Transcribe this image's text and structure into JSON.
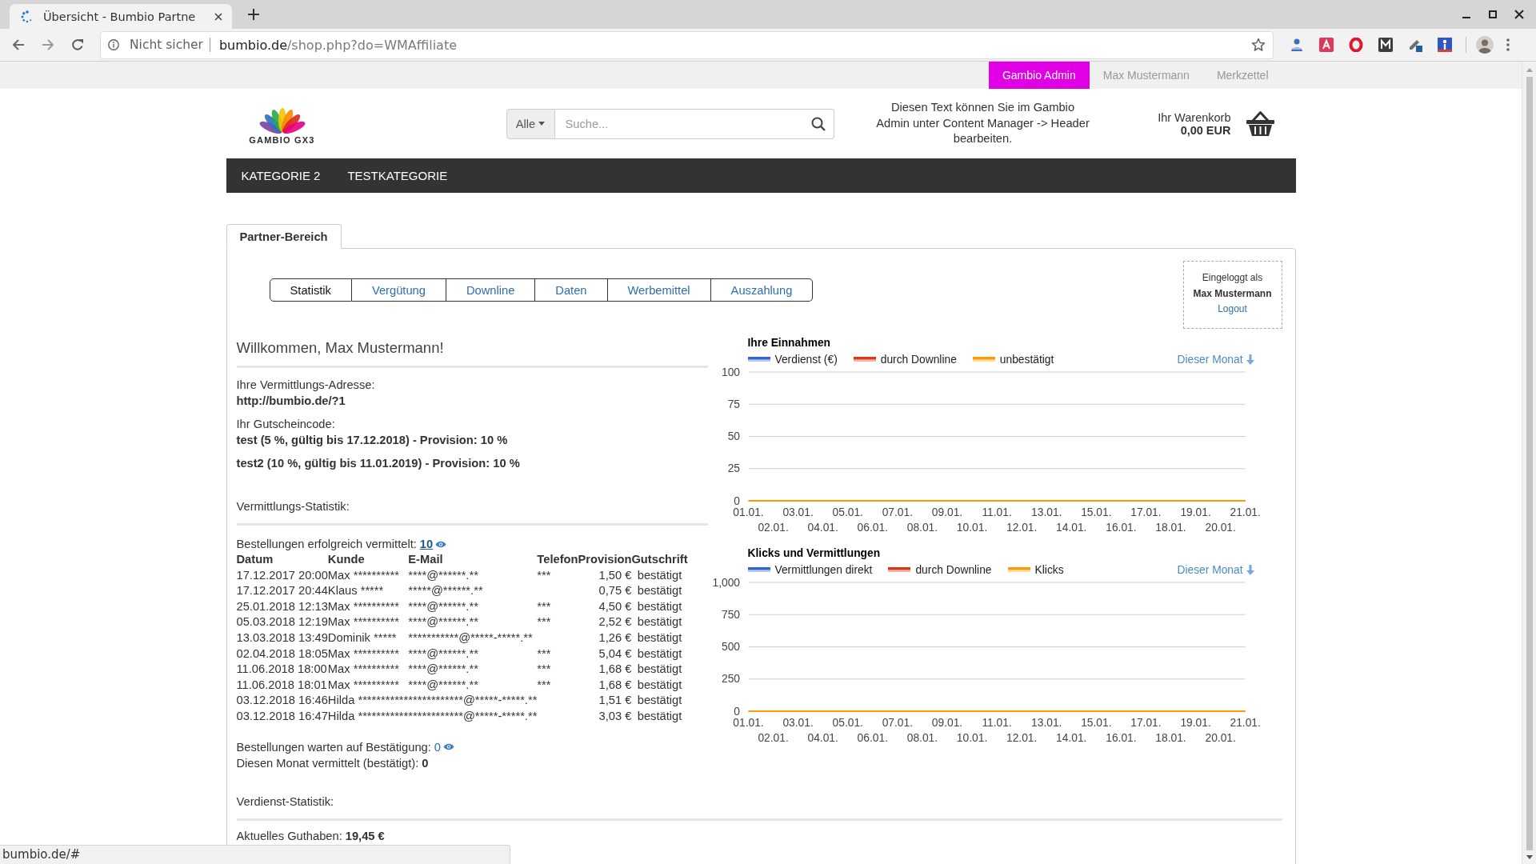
{
  "browser": {
    "tab": {
      "title": "Übersicht - Bumbio Partne",
      "loading": true
    },
    "address": {
      "security": "Nicht sicher",
      "host": "bumbio.de",
      "path": "/shop.php?do=WMAffiliate"
    }
  },
  "topbar": {
    "links": [
      {
        "label": "Gambio Admin",
        "kind": "admin"
      },
      {
        "label": "Max Mustermann",
        "kind": "link"
      },
      {
        "label": "Merkzettel",
        "kind": "link"
      }
    ]
  },
  "header": {
    "logo_text": "GAMBIO GX3",
    "search": {
      "category": "Alle",
      "placeholder": "Suche..."
    },
    "notice": "Diesen Text können Sie im Gambio\nAdmin unter Content Manager -> Header\nbearbeiten.",
    "cart": {
      "label": "Ihr Warenkorb",
      "total": "0,00 EUR"
    }
  },
  "nav": {
    "items": [
      {
        "label": "KATEGORIE 2"
      },
      {
        "label": "TESTKATEGORIE"
      }
    ]
  },
  "section_tab": {
    "label": "Partner-Bereich"
  },
  "subtabs": [
    {
      "label": "Statistik",
      "selected": true
    },
    {
      "label": "Vergütung",
      "selected": false
    },
    {
      "label": "Downline",
      "selected": false
    },
    {
      "label": "Daten",
      "selected": false
    },
    {
      "label": "Werbemittel",
      "selected": false
    },
    {
      "label": "Auszahlung",
      "selected": false
    }
  ],
  "login_box": {
    "label": "Eingeloggt als",
    "user": "Max Mustermann",
    "logout": "Logout"
  },
  "welcome": "Willkommen, Max Mustermann!",
  "referral": {
    "label": "Ihre Vermittlungs-Adresse:",
    "url": "http://bumbio.de/?1"
  },
  "vouchers": {
    "label": "Ihr Gutscheincode:",
    "codes": [
      "test (5 %, gültig bis 17.12.2018) - Provision: 10 %",
      "test2 (10 %, gültig bis 11.01.2019) - Provision: 10 %"
    ]
  },
  "referral_stats": {
    "heading": "Vermittlungs-Statistik:",
    "orders_label": "Bestellungen erfolgreich vermittelt:",
    "orders_count": "10",
    "table": {
      "columns": [
        "Datum",
        "Kunde",
        "E-Mail",
        "Telefon",
        "Provision",
        "Gutschrift"
      ],
      "rows": [
        {
          "date": "17.12.2017 20:00",
          "customer": "Max **********",
          "email": "****@******.**",
          "phone": "***",
          "provision": "1,50 €",
          "status": "bestätigt"
        },
        {
          "date": "17.12.2017 20:44",
          "customer": "Klaus *****",
          "email": "*****@******.**",
          "provision": "0,75 €",
          "status": "bestätigt"
        },
        {
          "date": "25.01.2018 12:13",
          "customer": "Max **********",
          "email": "****@******.**",
          "phone": "***",
          "provision": "4,50 €",
          "status": "bestätigt"
        },
        {
          "date": "05.03.2018 12:19",
          "customer": "Max **********",
          "email": "****@******.**",
          "phone": "***",
          "provision": "2,52 €",
          "status": "bestätigt"
        },
        {
          "date": "13.03.2018 13:49",
          "customer": "Dominik *****",
          "email": "***********@*****-*****.**",
          "provision": "1,26 €",
          "status": "bestätigt"
        },
        {
          "date": "02.04.2018 18:05",
          "customer": "Max **********",
          "email": "****@******.**",
          "phone": "***",
          "provision": "5,04 €",
          "status": "bestätigt"
        },
        {
          "date": "11.06.2018 18:00",
          "customer": "Max **********",
          "email": "****@******.**",
          "phone": "***",
          "provision": "1,68 €",
          "status": "bestätigt"
        },
        {
          "date": "11.06.2018 18:01",
          "customer": "Max **********",
          "email": "****@******.**",
          "phone": "***",
          "provision": "1,68 €",
          "status": "bestätigt"
        },
        {
          "date": "03.12.2018 16:46",
          "customer": "Hilda ***********",
          "email": "************@*****-*****.**",
          "provision": "1,51 €",
          "status": "bestätigt"
        },
        {
          "date": "03.12.2018 16:47",
          "customer": "Hilda ***********",
          "email": "************@*****-*****.**",
          "provision": "3,03 €",
          "status": "bestätigt"
        }
      ]
    },
    "pending_label": "Bestellungen warten auf Bestätigung:",
    "pending_count": "0",
    "month_label": "Diesen Monat vermittelt (bestätigt):",
    "month_count": "0"
  },
  "earnings_stats": {
    "heading": "Verdienst-Statistik:",
    "balance_label": "Aktuelles Guthaben:",
    "balance": "19,45 €"
  },
  "charts": [
    {
      "period_link": "Dieser Monat",
      "chart_data": {
        "type": "line",
        "title": "Ihre Einnahmen",
        "categories": [
          "01.01.",
          "02.01.",
          "03.01.",
          "04.01.",
          "05.01.",
          "06.01.",
          "07.01.",
          "08.01.",
          "09.01.",
          "10.01.",
          "11.01.",
          "12.01.",
          "13.01.",
          "14.01.",
          "15.01.",
          "16.01.",
          "17.01.",
          "18.01.",
          "19.01.",
          "20.01.",
          "21.01."
        ],
        "series": [
          {
            "name": "Verdienst (€)",
            "color": "#3366cc",
            "values": [
              null,
              null,
              null,
              null,
              null,
              null,
              null,
              null,
              null,
              null,
              null,
              null,
              null,
              null,
              null,
              null,
              null,
              null,
              null,
              null,
              null
            ]
          },
          {
            "name": "durch Downline",
            "color": "#dc3912",
            "values": [
              null,
              null,
              null,
              null,
              null,
              null,
              null,
              null,
              null,
              null,
              null,
              null,
              null,
              null,
              null,
              null,
              null,
              null,
              null,
              null,
              null
            ]
          },
          {
            "name": "unbestätigt",
            "color": "#ff9900",
            "values": [
              0,
              0,
              0,
              0,
              0,
              0,
              0,
              0,
              0,
              0,
              0,
              0,
              0,
              0,
              0,
              0,
              0,
              0,
              0,
              0,
              0
            ]
          }
        ],
        "ylim": [
          0,
          100
        ],
        "yticks": [
          0,
          25,
          50,
          75,
          100
        ],
        "grid": true,
        "legend": "top"
      }
    },
    {
      "period_link": "Dieser Monat",
      "chart_data": {
        "type": "line",
        "title": "Klicks und Vermittlungen",
        "categories": [
          "01.01.",
          "02.01.",
          "03.01.",
          "04.01.",
          "05.01.",
          "06.01.",
          "07.01.",
          "08.01.",
          "09.01.",
          "10.01.",
          "11.01.",
          "12.01.",
          "13.01.",
          "14.01.",
          "15.01.",
          "16.01.",
          "17.01.",
          "18.01.",
          "19.01.",
          "20.01.",
          "21.01."
        ],
        "series": [
          {
            "name": "Vermittlungen direkt",
            "color": "#3366cc",
            "values": [
              null,
              null,
              null,
              null,
              null,
              null,
              null,
              null,
              null,
              null,
              null,
              null,
              null,
              null,
              null,
              null,
              null,
              null,
              null,
              null,
              null
            ]
          },
          {
            "name": "durch Downline",
            "color": "#dc3912",
            "values": [
              null,
              null,
              null,
              null,
              null,
              null,
              null,
              null,
              null,
              null,
              null,
              null,
              null,
              null,
              null,
              null,
              null,
              null,
              null,
              null,
              null
            ]
          },
          {
            "name": "Klicks",
            "color": "#ff9900",
            "values": [
              0,
              0,
              0,
              0,
              0,
              0,
              0,
              0,
              0,
              0,
              0,
              0,
              0,
              0,
              0,
              0,
              0,
              0,
              0,
              0,
              0
            ]
          }
        ],
        "ylim": [
          0,
          1000
        ],
        "yticks": [
          0,
          250,
          500,
          750,
          {
            "value": 1000,
            "label": "1,000"
          }
        ],
        "grid": true,
        "legend": "top"
      }
    }
  ],
  "status_bar": {
    "text": "bumbio.de/#"
  }
}
